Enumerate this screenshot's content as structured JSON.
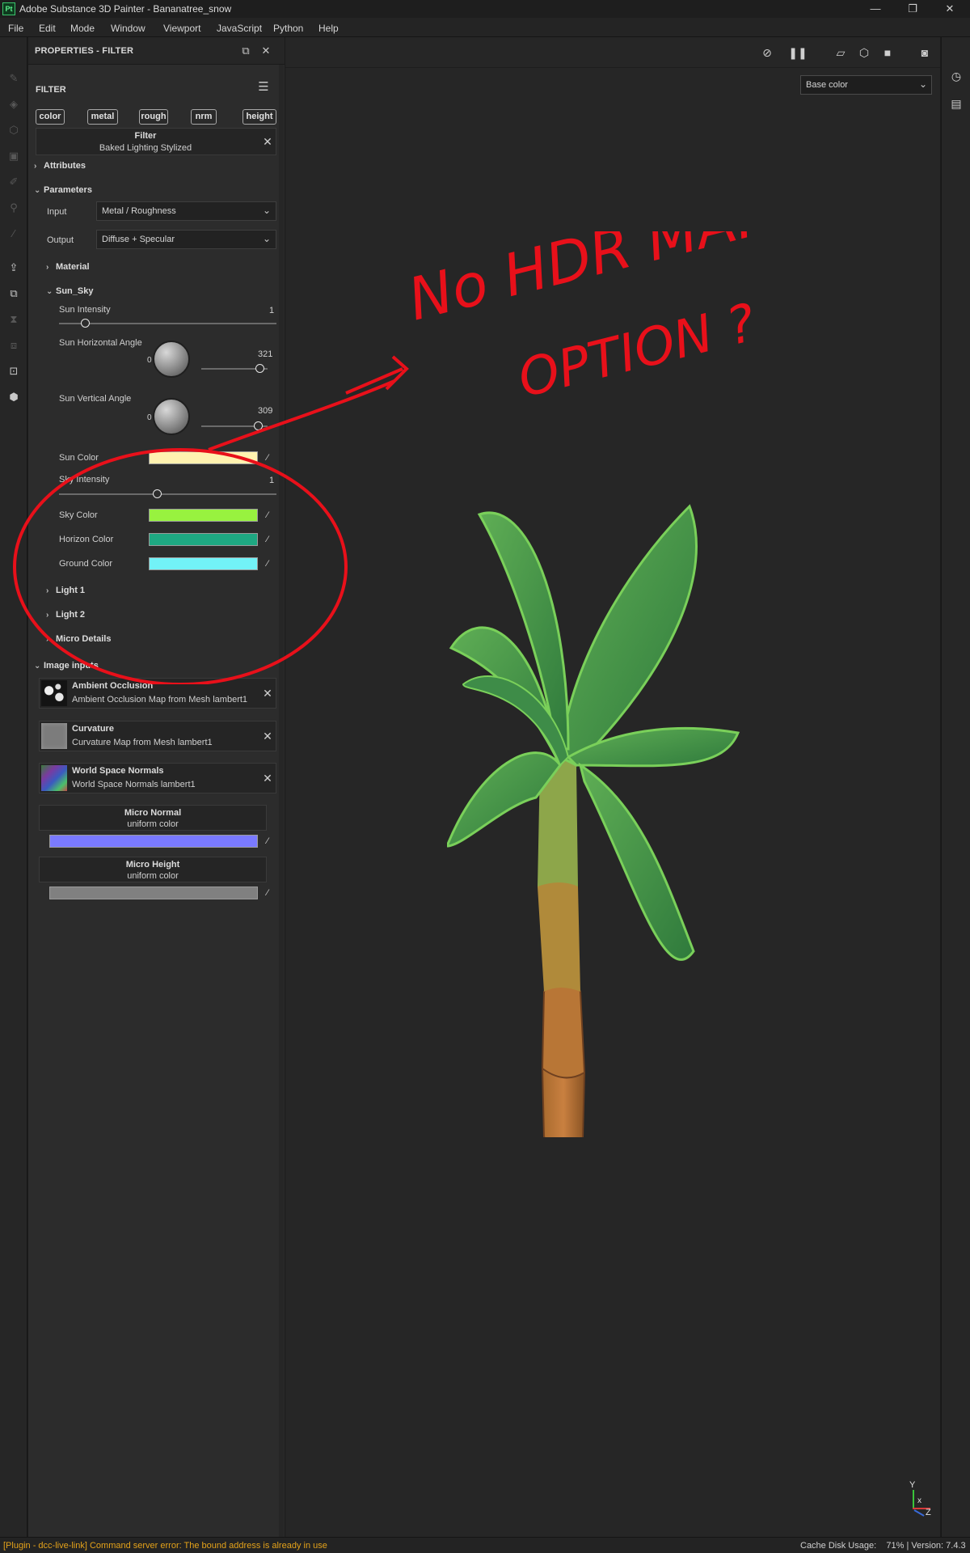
{
  "window": {
    "app_icon": "Pt",
    "title": "Adobe Substance 3D Painter - Bananatree_snow",
    "controls": [
      "—",
      "❐",
      "✕"
    ]
  },
  "menu": [
    "File",
    "Edit",
    "Mode",
    "Window",
    "Viewport",
    "JavaScript",
    "Python",
    "Help"
  ],
  "panel": {
    "title": "PROPERTIES - FILTER",
    "section_label": "FILTER",
    "channels": [
      "color",
      "metal",
      "rough",
      "nrm",
      "height"
    ],
    "filter": {
      "title": "Filter",
      "name": "Baked Lighting Stylized"
    },
    "attributes_label": "Attributes",
    "parameters_label": "Parameters",
    "input": {
      "label": "Input",
      "value": "Metal / Roughness"
    },
    "output": {
      "label": "Output",
      "value": "Diffuse + Specular"
    },
    "material_label": "Material",
    "sun_sky_label": "Sun_Sky",
    "sun_intensity": {
      "label": "Sun Intensity",
      "value": "1",
      "level": 0.12
    },
    "sun_h_angle": {
      "label": "Sun Horizontal Angle",
      "zero": "0",
      "value": "321",
      "level": 0.89
    },
    "sun_v_angle": {
      "label": "Sun Vertical Angle",
      "zero": "0",
      "value": "309",
      "level": 0.86
    },
    "sun_color": {
      "label": "Sun Color",
      "color": "#fff2b0"
    },
    "sky_intensity": {
      "label": "Sky Intensity",
      "value": "1",
      "level": 0.45
    },
    "sky_color": {
      "label": "Sky Color",
      "color": "#98f23f"
    },
    "horizon_color": {
      "label": "Horizon Color",
      "color": "#1ea882"
    },
    "ground_color": {
      "label": "Ground Color",
      "color": "#72f2f7"
    },
    "light1_label": "Light 1",
    "light2_label": "Light 2",
    "micro_details_label": "Micro Details",
    "image_inputs_label": "Image inputs",
    "image_inputs": [
      {
        "title": "Ambient Occlusion",
        "source": "Ambient Occlusion Map from Mesh lambert1"
      },
      {
        "title": "Curvature",
        "source": "Curvature Map from Mesh lambert1"
      },
      {
        "title": "World Space Normals",
        "source": "World Space Normals lambert1"
      }
    ],
    "micro_normal": {
      "title": "Micro Normal",
      "sub": "uniform color",
      "color": "#7a7aff"
    },
    "micro_height": {
      "title": "Micro Height",
      "sub": "uniform color",
      "color": "#808080"
    }
  },
  "viewport": {
    "channel_select": "Base color",
    "axis": {
      "y": "Y",
      "x": "x",
      "z": "Z"
    }
  },
  "annotation": {
    "line1": "No HDR MAP",
    "line2": "OPTION ?",
    "color": "#e8101a"
  },
  "status": {
    "message": "[Plugin - dcc-live-link] Command server error: The bound address is already in use",
    "right": "Cache Disk Usage:    71% | Version: 7.4.3"
  }
}
